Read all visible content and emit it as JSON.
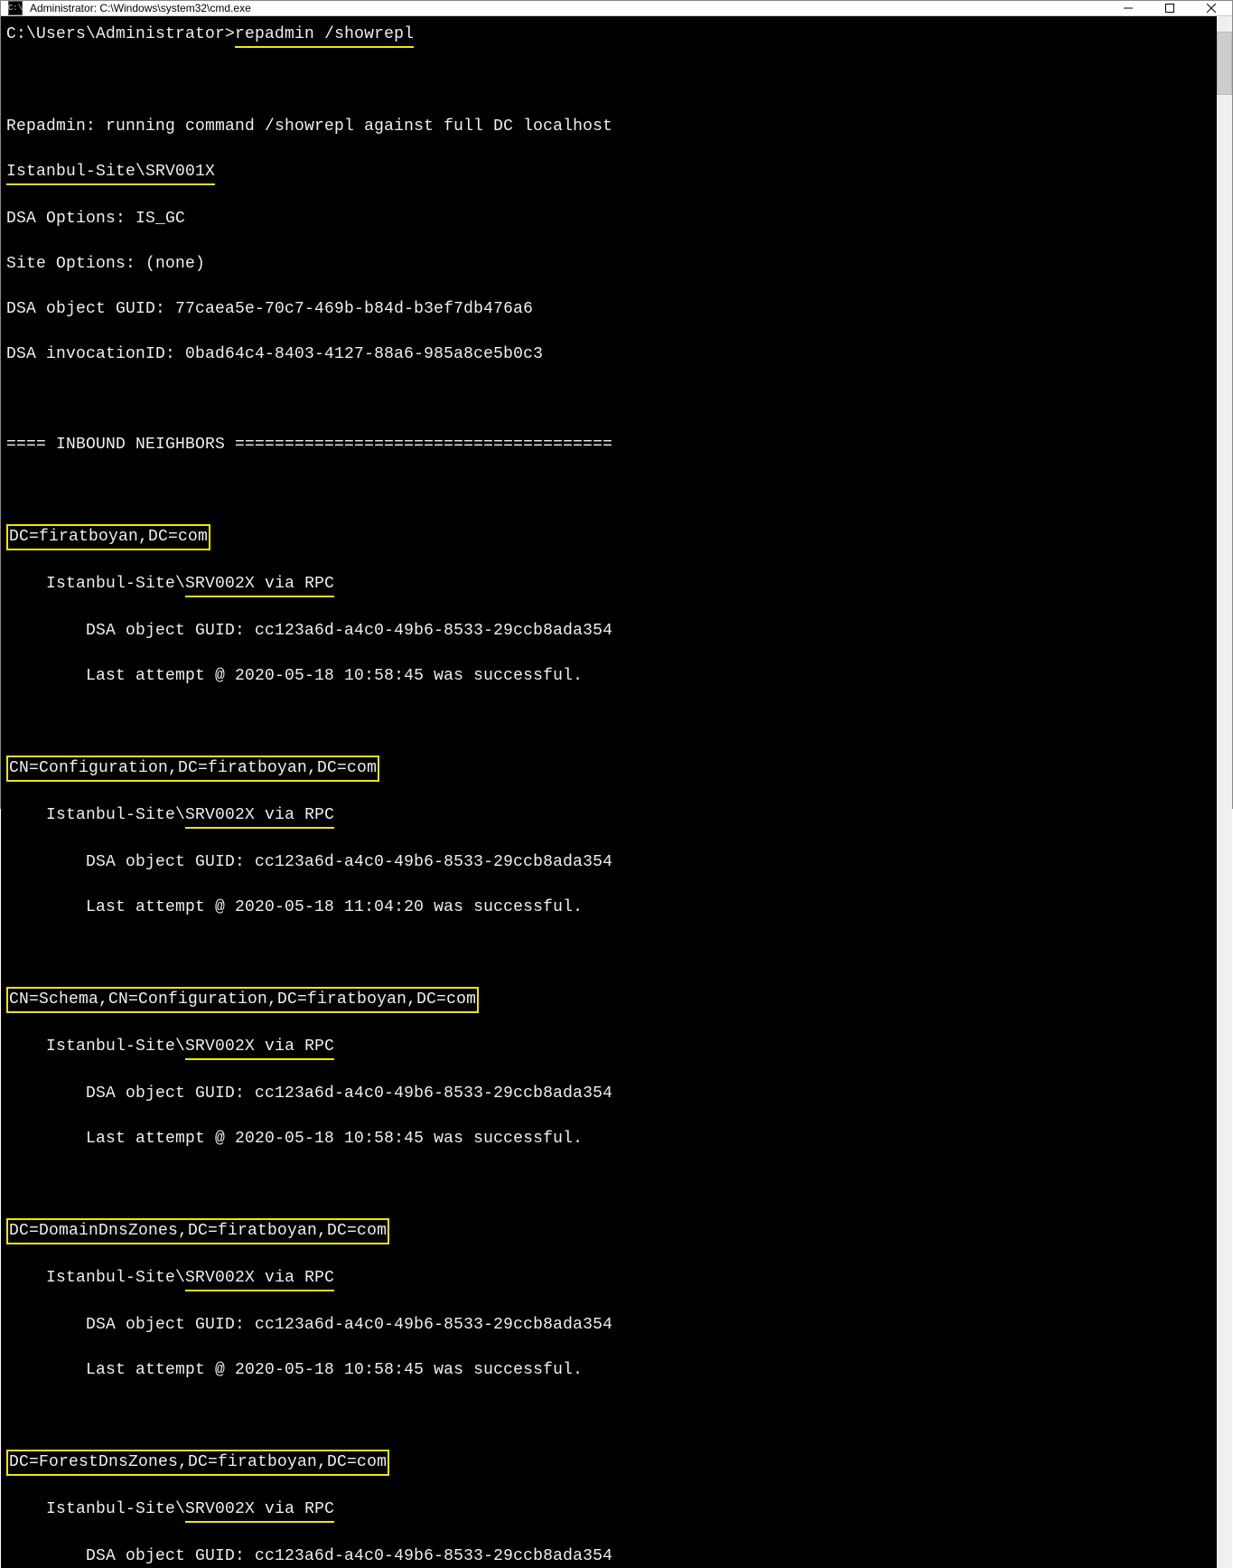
{
  "window": {
    "icon_text": "C:\\",
    "title": "Administrator: C:\\Windows\\system32\\cmd.exe"
  },
  "prompt": {
    "path": "C:\\Users\\Administrator>",
    "command": "repadmin /showrepl"
  },
  "header": {
    "running_line": "Repadmin: running command /showrepl against full DC localhost",
    "site_dc": "Istanbul-Site\\SRV001X",
    "dsa_options": "DSA Options: IS_GC",
    "site_options": "Site Options: (none)",
    "dsa_guid": "DSA object GUID: 77caea5e-70c7-469b-b84d-b3ef7db476a6",
    "dsa_invocation": "DSA invocationID: 0bad64c4-8403-4127-88a6-985a8ce5b0c3"
  },
  "neighbors_header": "==== INBOUND NEIGHBORS ======================================",
  "blocks": [
    {
      "dn": "DC=firatboyan,DC=com",
      "site_prefix": "    Istanbul-Site\\",
      "site_link": "SRV002X via RPC",
      "guid_line": "        DSA object GUID: cc123a6d-a4c0-49b6-8533-29ccb8ada354",
      "attempt_line": "        Last attempt @ 2020-05-18 10:58:45 was successful."
    },
    {
      "dn": "CN=Configuration,DC=firatboyan,DC=com",
      "site_prefix": "    Istanbul-Site\\",
      "site_link": "SRV002X via RPC",
      "guid_line": "        DSA object GUID: cc123a6d-a4c0-49b6-8533-29ccb8ada354",
      "attempt_line": "        Last attempt @ 2020-05-18 11:04:20 was successful."
    },
    {
      "dn": "CN=Schema,CN=Configuration,DC=firatboyan,DC=com",
      "site_prefix": "    Istanbul-Site\\",
      "site_link": "SRV002X via RPC",
      "guid_line": "        DSA object GUID: cc123a6d-a4c0-49b6-8533-29ccb8ada354",
      "attempt_line": "        Last attempt @ 2020-05-18 10:58:45 was successful."
    },
    {
      "dn": "DC=DomainDnsZones,DC=firatboyan,DC=com",
      "site_prefix": "    Istanbul-Site\\",
      "site_link": "SRV002X via RPC",
      "guid_line": "        DSA object GUID: cc123a6d-a4c0-49b6-8533-29ccb8ada354",
      "attempt_line": "        Last attempt @ 2020-05-18 10:58:45 was successful."
    },
    {
      "dn": "DC=ForestDnsZones,DC=firatboyan,DC=com",
      "site_prefix": "    Istanbul-Site\\",
      "site_link": "SRV002X via RPC",
      "guid_line": "        DSA object GUID: cc123a6d-a4c0-49b6-8533-29ccb8ada354",
      "attempt_line": ""
    }
  ]
}
